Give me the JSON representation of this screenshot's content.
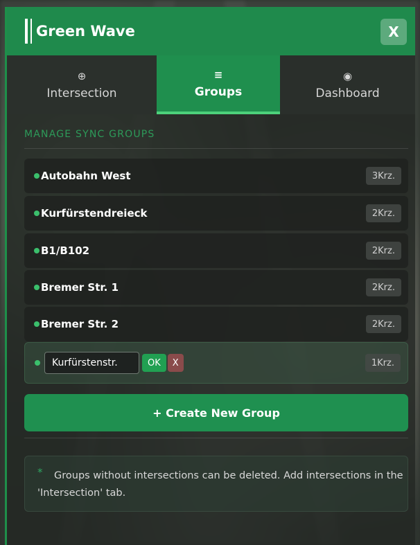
{
  "app": {
    "title": "Green Wave",
    "close_label": "X"
  },
  "tabs": [
    {
      "icon": "⊕",
      "icon_name": "crosshair-icon",
      "label": "Intersection"
    },
    {
      "icon": "≡",
      "icon_name": "list-icon",
      "label": "Groups"
    },
    {
      "icon": "◉",
      "icon_name": "radio-icon",
      "label": "Dashboard"
    }
  ],
  "section_title": "MANAGE SYNC GROUPS",
  "groups": [
    {
      "name": "Autobahn West",
      "count": "3Krz."
    },
    {
      "name": "Kurfürstendreieck",
      "count": "2Krz."
    },
    {
      "name": "B1/B102",
      "count": "2Krz."
    },
    {
      "name": "Bremer Str. 1",
      "count": "2Krz."
    },
    {
      "name": "Bremer Str. 2",
      "count": "2Krz."
    }
  ],
  "editing_group": {
    "value": "Kurfürstenstr.",
    "ok_label": "OK",
    "cancel_label": "X",
    "count": "1Krz."
  },
  "create_button": "+ Create New Group",
  "info": {
    "star": "*",
    "text": "Groups without intersections can be deleted. Add intersections in the 'Intersection' tab."
  },
  "colors": {
    "accent": "#1f8a4c",
    "dot": "#3bbf6c",
    "active_tab": "#1f8f4e"
  }
}
